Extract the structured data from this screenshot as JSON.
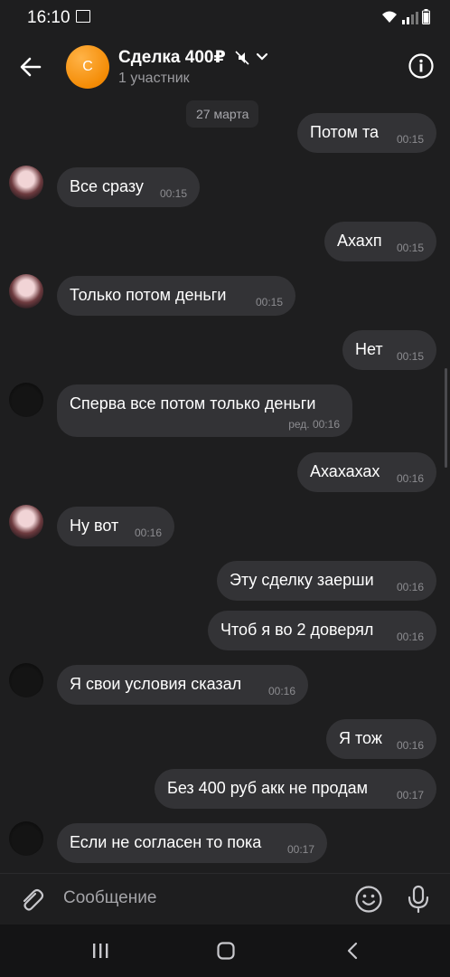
{
  "status": {
    "time": "16:10"
  },
  "header": {
    "avatar_letter": "С",
    "title": "Сделка 400₽",
    "subtitle": "1 участник"
  },
  "date_chip": "27 марта",
  "messages": [
    {
      "side": "out",
      "text": "Потом та",
      "time": "00:15"
    },
    {
      "side": "in",
      "text": "Все сразу",
      "time": "00:15",
      "avatar": "pink"
    },
    {
      "side": "out",
      "text": "Ахахп",
      "time": "00:15"
    },
    {
      "side": "in",
      "text": "Только потом деньги",
      "time": "00:15",
      "avatar": "pink"
    },
    {
      "side": "out",
      "text": "Нет",
      "time": "00:15"
    },
    {
      "side": "in",
      "text": "Сперва все потом только деньги",
      "time": "ред. 00:16",
      "avatar": "dark"
    },
    {
      "side": "out",
      "text": "Ахахахах",
      "time": "00:16"
    },
    {
      "side": "in",
      "text": "Ну вот",
      "time": "00:16",
      "avatar": "pink"
    },
    {
      "side": "out",
      "text": "Эту сделку заерши",
      "time": "00:16"
    },
    {
      "side": "out",
      "text": "Чтоб я во 2 доверял",
      "time": "00:16"
    },
    {
      "side": "in",
      "text": "Я свои условия сказал",
      "time": "00:16",
      "avatar": "dark"
    },
    {
      "side": "out",
      "text": "Я тож",
      "time": "00:16"
    },
    {
      "side": "out",
      "text": "Без 400 руб акк не продам",
      "time": "00:17"
    },
    {
      "side": "in",
      "text": "Если не согласен то пока",
      "time": "00:17",
      "avatar": "dark"
    }
  ],
  "composer": {
    "placeholder": "Сообщение"
  },
  "icons": {
    "back": "arrow-left-icon",
    "mute": "mute-icon",
    "chevron": "chevron-down-icon",
    "info": "info-icon",
    "attach": "paperclip-icon",
    "emoji": "emoji-icon",
    "mic": "microphone-icon",
    "nav_recents": "recents-icon",
    "nav_home": "home-icon",
    "nav_back": "nav-back-icon"
  },
  "colors": {
    "background": "#1e1e1f",
    "bubble": "#333336",
    "accent": "#f48c06"
  }
}
